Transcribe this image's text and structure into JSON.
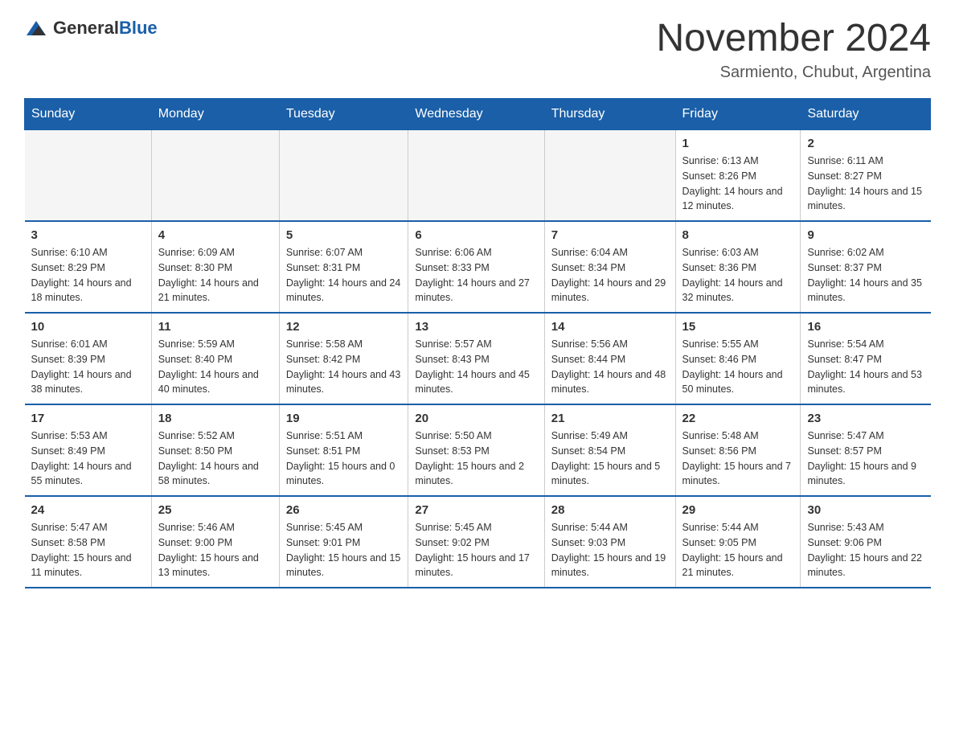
{
  "header": {
    "logo_general": "General",
    "logo_blue": "Blue",
    "month_title": "November 2024",
    "location": "Sarmiento, Chubut, Argentina"
  },
  "weekdays": [
    "Sunday",
    "Monday",
    "Tuesday",
    "Wednesday",
    "Thursday",
    "Friday",
    "Saturday"
  ],
  "weeks": [
    [
      {
        "day": "",
        "sunrise": "",
        "sunset": "",
        "daylight": ""
      },
      {
        "day": "",
        "sunrise": "",
        "sunset": "",
        "daylight": ""
      },
      {
        "day": "",
        "sunrise": "",
        "sunset": "",
        "daylight": ""
      },
      {
        "day": "",
        "sunrise": "",
        "sunset": "",
        "daylight": ""
      },
      {
        "day": "",
        "sunrise": "",
        "sunset": "",
        "daylight": ""
      },
      {
        "day": "1",
        "sunrise": "Sunrise: 6:13 AM",
        "sunset": "Sunset: 8:26 PM",
        "daylight": "Daylight: 14 hours and 12 minutes."
      },
      {
        "day": "2",
        "sunrise": "Sunrise: 6:11 AM",
        "sunset": "Sunset: 8:27 PM",
        "daylight": "Daylight: 14 hours and 15 minutes."
      }
    ],
    [
      {
        "day": "3",
        "sunrise": "Sunrise: 6:10 AM",
        "sunset": "Sunset: 8:29 PM",
        "daylight": "Daylight: 14 hours and 18 minutes."
      },
      {
        "day": "4",
        "sunrise": "Sunrise: 6:09 AM",
        "sunset": "Sunset: 8:30 PM",
        "daylight": "Daylight: 14 hours and 21 minutes."
      },
      {
        "day": "5",
        "sunrise": "Sunrise: 6:07 AM",
        "sunset": "Sunset: 8:31 PM",
        "daylight": "Daylight: 14 hours and 24 minutes."
      },
      {
        "day": "6",
        "sunrise": "Sunrise: 6:06 AM",
        "sunset": "Sunset: 8:33 PM",
        "daylight": "Daylight: 14 hours and 27 minutes."
      },
      {
        "day": "7",
        "sunrise": "Sunrise: 6:04 AM",
        "sunset": "Sunset: 8:34 PM",
        "daylight": "Daylight: 14 hours and 29 minutes."
      },
      {
        "day": "8",
        "sunrise": "Sunrise: 6:03 AM",
        "sunset": "Sunset: 8:36 PM",
        "daylight": "Daylight: 14 hours and 32 minutes."
      },
      {
        "day": "9",
        "sunrise": "Sunrise: 6:02 AM",
        "sunset": "Sunset: 8:37 PM",
        "daylight": "Daylight: 14 hours and 35 minutes."
      }
    ],
    [
      {
        "day": "10",
        "sunrise": "Sunrise: 6:01 AM",
        "sunset": "Sunset: 8:39 PM",
        "daylight": "Daylight: 14 hours and 38 minutes."
      },
      {
        "day": "11",
        "sunrise": "Sunrise: 5:59 AM",
        "sunset": "Sunset: 8:40 PM",
        "daylight": "Daylight: 14 hours and 40 minutes."
      },
      {
        "day": "12",
        "sunrise": "Sunrise: 5:58 AM",
        "sunset": "Sunset: 8:42 PM",
        "daylight": "Daylight: 14 hours and 43 minutes."
      },
      {
        "day": "13",
        "sunrise": "Sunrise: 5:57 AM",
        "sunset": "Sunset: 8:43 PM",
        "daylight": "Daylight: 14 hours and 45 minutes."
      },
      {
        "day": "14",
        "sunrise": "Sunrise: 5:56 AM",
        "sunset": "Sunset: 8:44 PM",
        "daylight": "Daylight: 14 hours and 48 minutes."
      },
      {
        "day": "15",
        "sunrise": "Sunrise: 5:55 AM",
        "sunset": "Sunset: 8:46 PM",
        "daylight": "Daylight: 14 hours and 50 minutes."
      },
      {
        "day": "16",
        "sunrise": "Sunrise: 5:54 AM",
        "sunset": "Sunset: 8:47 PM",
        "daylight": "Daylight: 14 hours and 53 minutes."
      }
    ],
    [
      {
        "day": "17",
        "sunrise": "Sunrise: 5:53 AM",
        "sunset": "Sunset: 8:49 PM",
        "daylight": "Daylight: 14 hours and 55 minutes."
      },
      {
        "day": "18",
        "sunrise": "Sunrise: 5:52 AM",
        "sunset": "Sunset: 8:50 PM",
        "daylight": "Daylight: 14 hours and 58 minutes."
      },
      {
        "day": "19",
        "sunrise": "Sunrise: 5:51 AM",
        "sunset": "Sunset: 8:51 PM",
        "daylight": "Daylight: 15 hours and 0 minutes."
      },
      {
        "day": "20",
        "sunrise": "Sunrise: 5:50 AM",
        "sunset": "Sunset: 8:53 PM",
        "daylight": "Daylight: 15 hours and 2 minutes."
      },
      {
        "day": "21",
        "sunrise": "Sunrise: 5:49 AM",
        "sunset": "Sunset: 8:54 PM",
        "daylight": "Daylight: 15 hours and 5 minutes."
      },
      {
        "day": "22",
        "sunrise": "Sunrise: 5:48 AM",
        "sunset": "Sunset: 8:56 PM",
        "daylight": "Daylight: 15 hours and 7 minutes."
      },
      {
        "day": "23",
        "sunrise": "Sunrise: 5:47 AM",
        "sunset": "Sunset: 8:57 PM",
        "daylight": "Daylight: 15 hours and 9 minutes."
      }
    ],
    [
      {
        "day": "24",
        "sunrise": "Sunrise: 5:47 AM",
        "sunset": "Sunset: 8:58 PM",
        "daylight": "Daylight: 15 hours and 11 minutes."
      },
      {
        "day": "25",
        "sunrise": "Sunrise: 5:46 AM",
        "sunset": "Sunset: 9:00 PM",
        "daylight": "Daylight: 15 hours and 13 minutes."
      },
      {
        "day": "26",
        "sunrise": "Sunrise: 5:45 AM",
        "sunset": "Sunset: 9:01 PM",
        "daylight": "Daylight: 15 hours and 15 minutes."
      },
      {
        "day": "27",
        "sunrise": "Sunrise: 5:45 AM",
        "sunset": "Sunset: 9:02 PM",
        "daylight": "Daylight: 15 hours and 17 minutes."
      },
      {
        "day": "28",
        "sunrise": "Sunrise: 5:44 AM",
        "sunset": "Sunset: 9:03 PM",
        "daylight": "Daylight: 15 hours and 19 minutes."
      },
      {
        "day": "29",
        "sunrise": "Sunrise: 5:44 AM",
        "sunset": "Sunset: 9:05 PM",
        "daylight": "Daylight: 15 hours and 21 minutes."
      },
      {
        "day": "30",
        "sunrise": "Sunrise: 5:43 AM",
        "sunset": "Sunset: 9:06 PM",
        "daylight": "Daylight: 15 hours and 22 minutes."
      }
    ]
  ]
}
